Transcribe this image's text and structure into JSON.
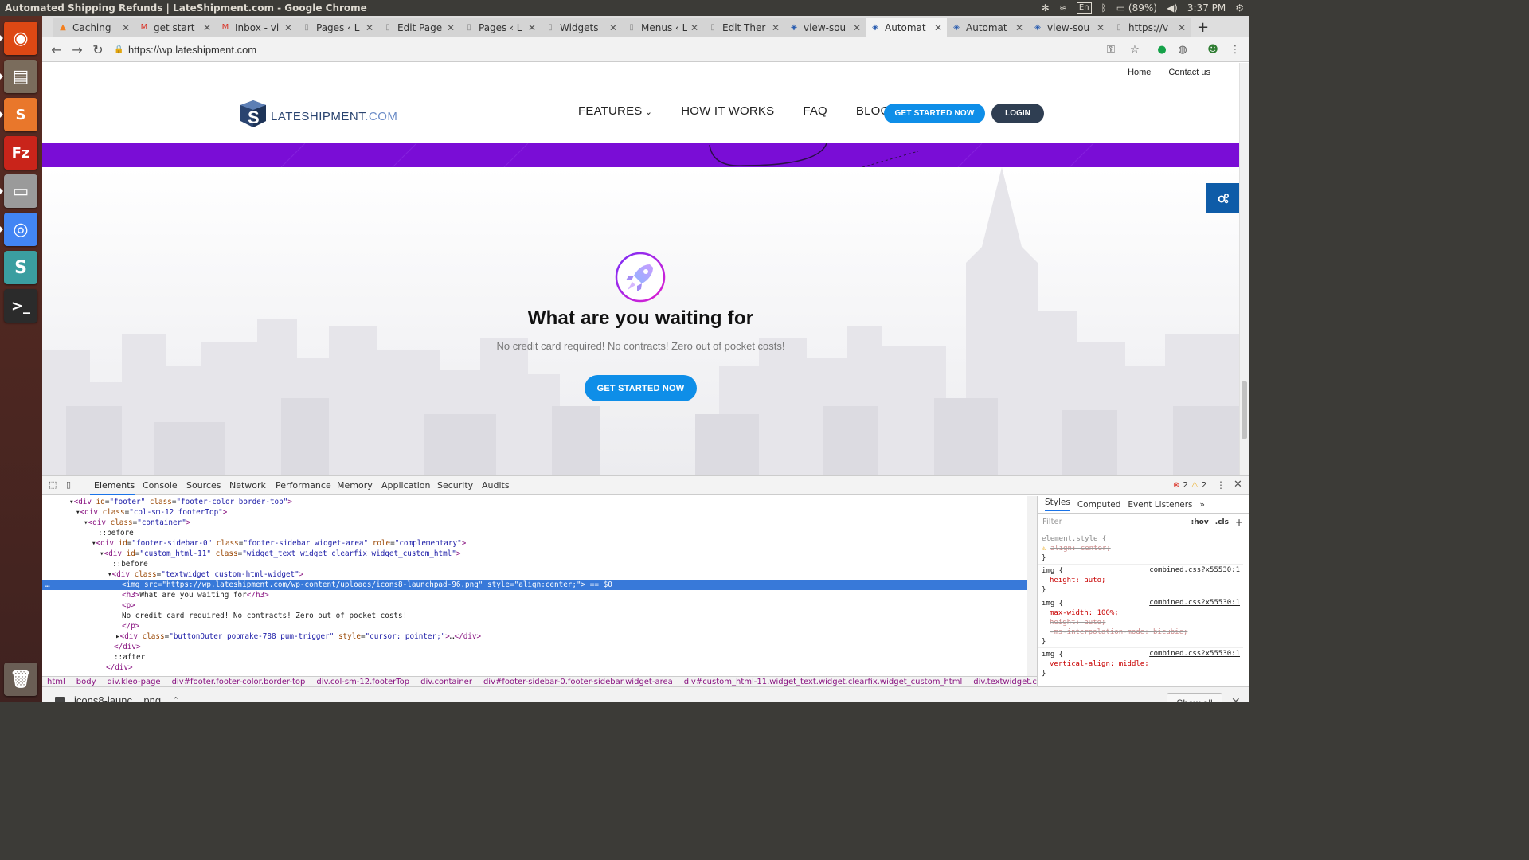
{
  "os": {
    "window_title": "Automated Shipping Refunds | LateShipment.com - Google Chrome",
    "keyboard_layout": "En",
    "battery": "(89%)",
    "clock": "3:37 PM"
  },
  "launcher": {
    "items": [
      {
        "name": "ubuntu-dash-icon",
        "glyph": "◉",
        "color": "#dd4814"
      },
      {
        "name": "files-icon",
        "glyph": "▤",
        "color": "#7a6c5c"
      },
      {
        "name": "sublime-text-icon",
        "glyph": "S",
        "color": "#e9772b"
      },
      {
        "name": "filezilla-icon",
        "glyph": "Fz",
        "color": "#c9241a"
      },
      {
        "name": "disk-icon",
        "glyph": "▭",
        "color": "#9a9a9a"
      },
      {
        "name": "chrome-icon",
        "glyph": "◎",
        "color": "#4285f4"
      },
      {
        "name": "slack-icon",
        "glyph": "S",
        "color": "#3b9ea0"
      },
      {
        "name": "terminal-icon",
        "glyph": ">_",
        "color": "#2b2b2b"
      },
      {
        "name": "trash-icon",
        "glyph": "🗑",
        "color": "#6a5e55"
      }
    ]
  },
  "tabs": [
    {
      "label": "Caching",
      "fav": "▲",
      "fav_color": "#f38020"
    },
    {
      "label": "get start",
      "fav": "M",
      "fav_color": "#d93025"
    },
    {
      "label": "Inbox - vi",
      "fav": "M",
      "fav_color": "#d93025"
    },
    {
      "label": "Pages ‹ L",
      "fav": "▯",
      "fav_color": "#888"
    },
    {
      "label": "Edit Page",
      "fav": "▯",
      "fav_color": "#888"
    },
    {
      "label": "Pages ‹ L",
      "fav": "▯",
      "fav_color": "#888"
    },
    {
      "label": "Widgets",
      "fav": "▯",
      "fav_color": "#888"
    },
    {
      "label": "Menus ‹ L",
      "fav": "▯",
      "fav_color": "#888"
    },
    {
      "label": "Edit Ther",
      "fav": "▯",
      "fav_color": "#888"
    },
    {
      "label": "view-sou",
      "fav": "◈",
      "fav_color": "#2a5db0"
    },
    {
      "label": "Automat",
      "fav": "◈",
      "fav_color": "#2a5db0",
      "active": true
    },
    {
      "label": "Automat",
      "fav": "◈",
      "fav_color": "#2a5db0"
    },
    {
      "label": "view-sou",
      "fav": "◈",
      "fav_color": "#2a5db0"
    },
    {
      "label": "https://v",
      "fav": "▯",
      "fav_color": "#888"
    }
  ],
  "toolbar": {
    "url": "https://wp.lateshipment.com"
  },
  "page": {
    "top_links": [
      "Home",
      "Contact us"
    ],
    "logo": {
      "main": "LATESHIPMENT",
      "suffix": ".COM"
    },
    "nav": [
      "FEATURES",
      "HOW IT WORKS",
      "FAQ",
      "BLOG"
    ],
    "get_started_label": "GET STARTED NOW",
    "login_label": "LOGIN",
    "hero_title": "What are you waiting for",
    "hero_subtitle": "No credit card required! No contracts! Zero out of pocket costs!",
    "hero_button": "GET STARTED NOW",
    "colors": {
      "accent": "#0e8ee8",
      "band": "#7a0dd6",
      "login": "#2f3e52"
    }
  },
  "devtools": {
    "tabs": [
      "Elements",
      "Console",
      "Sources",
      "Network",
      "Performance",
      "Memory",
      "Application",
      "Security",
      "Audits"
    ],
    "errors": "2",
    "warnings": "2",
    "dom_lines": [
      {
        "html": "▾&lt;div <span class='an'>id</span>=<span class='av'>\"footer\"</span> <span class='an'>class</span>=<span class='av'>\"footer-color border-top\"</span>&gt;"
      },
      {
        "html": "▾&lt;div <span class='an'>class</span>=<span class='av'>\"col-sm-12 footerTop\"</span>&gt;"
      },
      {
        "html": "▾&lt;div <span class='an'>class</span>=<span class='av'>\"container\"</span>&gt;"
      },
      {
        "html": "::before"
      },
      {
        "html": "▾&lt;div <span class='an'>id</span>=<span class='av'>\"footer-sidebar-0\"</span> <span class='an'>class</span>=<span class='av'>\"footer-sidebar widget-area\"</span> <span class='an'>role</span>=<span class='av'>\"complementary\"</span>&gt;"
      },
      {
        "html": "▾&lt;div <span class='an'>id</span>=<span class='av'>\"custom_html-11\"</span> <span class='an'>class</span>=<span class='av'>\"widget_text widget clearfix widget_custom_html\"</span>&gt;"
      },
      {
        "html": "::before"
      },
      {
        "html": "▾&lt;div <span class='an'>class</span>=<span class='av'>\"textwidget custom-html-widget\"</span>&gt;"
      },
      {
        "html": "&lt;img <span class='an'>src</span>=<span class='av' style='text-decoration:underline'>\"https://wp.lateshipment.com/wp-content/uploads/icons8-launchpad-96.png\"</span> <span class='an'>style</span>=<span class='av'>\"align:center;\"</span>&gt; == $0",
        "selected": true
      },
      {
        "html": "&lt;h3&gt;What are you waiting for&lt;/h3&gt;"
      },
      {
        "html": "&lt;p&gt;"
      },
      {
        "html": "No credit card required! No contracts! Zero out of pocket costs!"
      },
      {
        "html": "&lt;/p&gt;"
      },
      {
        "html": "▸&lt;div <span class='an'>class</span>=<span class='av'>\"buttonOuter popmake-788 pum-trigger\"</span> <span class='an'>style</span>=<span class='av'>\"cursor: pointer;\"</span>&gt;…&lt;/div&gt;"
      },
      {
        "html": "&lt;/div&gt;"
      },
      {
        "html": "::after"
      },
      {
        "html": "&lt;/div&gt;"
      }
    ],
    "breadcrumb": [
      "html",
      "body",
      "div.kleo-page",
      "div#footer.footer-color.border-top",
      "div.col-sm-12.footerTop",
      "div.container",
      "div#footer-sidebar-0.footer-sidebar.widget-area",
      "div#custom_html-11.widget_text.widget.clearfix.widget_custom_html",
      "div.textwidget.custom-html-widget",
      "img"
    ],
    "styles_tabs": [
      "Styles",
      "Computed",
      "Event Listeners",
      "»"
    ],
    "filter_placeholder": "Filter",
    "hov_label": ":hov",
    "cls_label": ".cls",
    "rules": {
      "element_style": "element.style {",
      "element_prop": "align: center;",
      "img1_sel": "img {",
      "img1_src": "combined.css?x55530:1",
      "img1_prop": "height: auto;",
      "img2_sel": "img {",
      "img2_src": "combined.css?x55530:1",
      "img2_prop1": "max-width: 100%;",
      "img2_prop2": "height: auto;",
      "img2_prop3": "-ms-interpolation-mode: bicubic;",
      "img3_sel": "img {",
      "img3_src": "combined.css?x55530:1",
      "img3_prop": "vertical-align: middle;",
      "close": "}"
    }
  },
  "downloads": {
    "file": "icons8-launc....png",
    "show_all": "Show all"
  }
}
